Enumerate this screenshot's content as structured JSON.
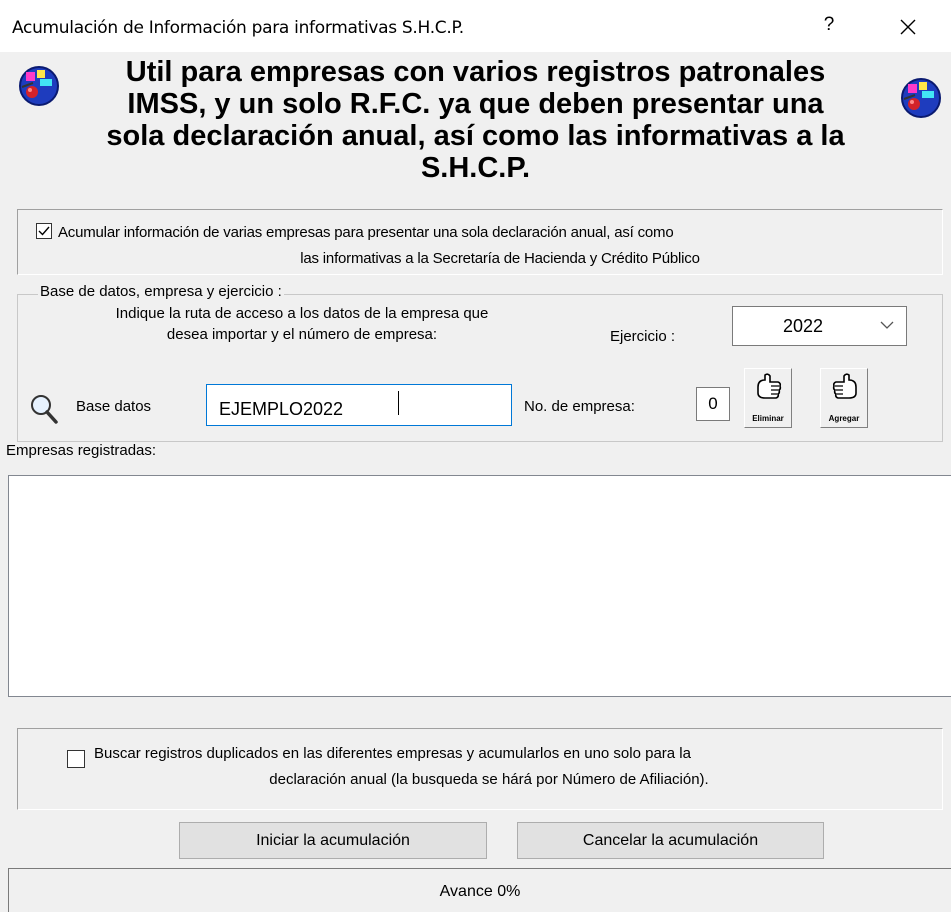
{
  "window": {
    "title": "Acumulación de Información para informativas S.H.C.P.",
    "help_label": "?"
  },
  "header": {
    "line1": "Util para empresas con varios registros patronales",
    "line2": "IMSS, y un solo R.F.C. ya que deben presentar una",
    "line3": "sola declaración anual, así como las informativas a la",
    "line4": "S.H.C.P."
  },
  "accumulate_option": {
    "checked": true,
    "line1": "Acumular información de varias empresas para presentar una sola declaración anual, así como",
    "line2": "las informativas a la Secretaría de Hacienda y Crédito Público"
  },
  "database_group": {
    "legend": "Base de datos, empresa y ejercicio :",
    "hint_line1": "Indique la ruta de acceso a los datos de la empresa que",
    "hint_line2": "desea importar y el número de empresa:",
    "ejercicio_label": "Ejercicio :",
    "ejercicio_value": "2022",
    "db_label": "Base datos",
    "db_value": "EJEMPLO2022",
    "empresa_label": "No. de empresa:",
    "empresa_value": "0",
    "remove_label": "Eliminar",
    "add_label": "Agregar"
  },
  "registered": {
    "label": "Empresas registradas:",
    "items": []
  },
  "duplicates_option": {
    "checked": false,
    "line1": "Buscar registros duplicados en las diferentes empresas y acumularlos en uno solo para la",
    "line2": "declaración anual (la busqueda se hárá por Número de Afiliación)."
  },
  "actions": {
    "start_label": "Iniciar la acumulación",
    "cancel_label": "Cancelar la acumulación"
  },
  "progress": {
    "text": "Avance  0%",
    "fraction": 0
  },
  "colors": {
    "title_bar": "#ffffff",
    "dialog_bg": "#f0f0f0",
    "focus_border": "#0078d7",
    "progress_fill": "#06b025"
  }
}
